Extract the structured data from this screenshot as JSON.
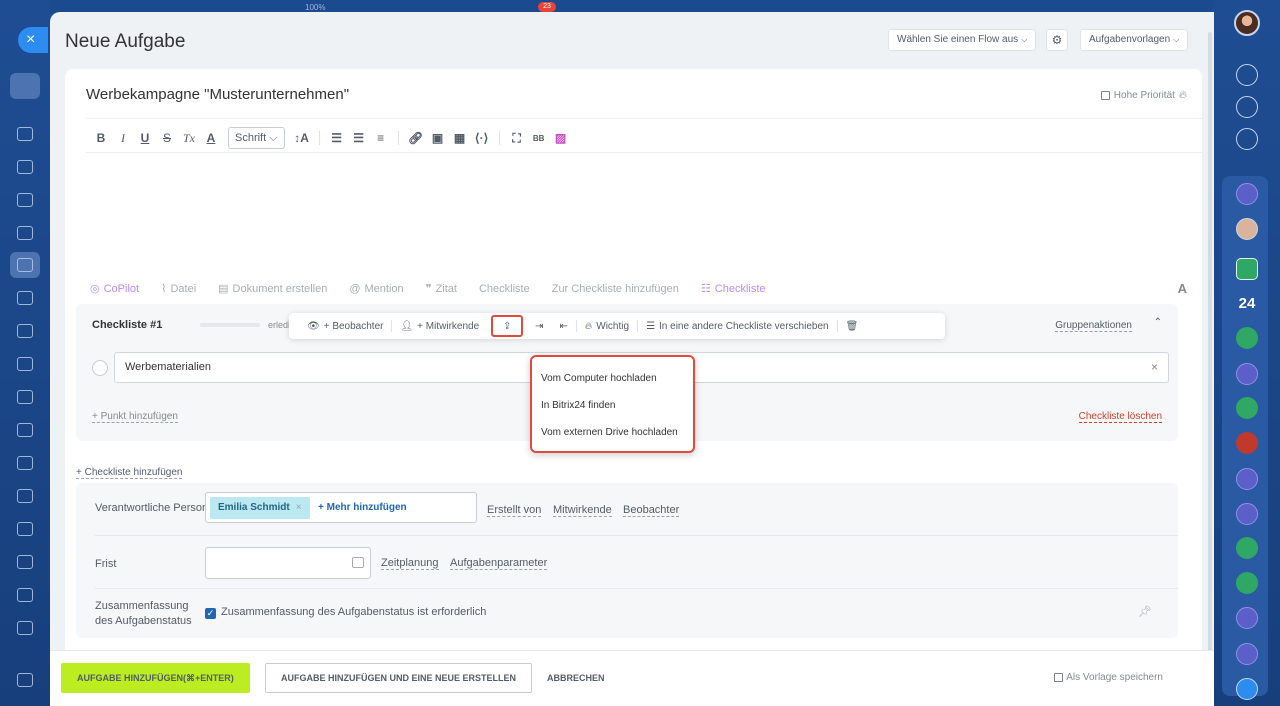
{
  "background": {
    "top_percent": "100%",
    "top_counter": "23",
    "right_rail_count": "24"
  },
  "header": {
    "title": "Neue Aufgabe",
    "flow_select": "Wählen Sie einen Flow aus",
    "templates": "Aufgabenvorlagen"
  },
  "task": {
    "title": "Werbekampagne \"Musterunternehmen\"",
    "high_priority": "Hohe Priorität"
  },
  "editor": {
    "toolbar": {
      "bold": "B",
      "italic": "I",
      "underline": "U",
      "strike": "S",
      "clear": "Tx",
      "color": "A",
      "font": "Schrift",
      "font_size": "↕A"
    },
    "actions": {
      "copilot": "CoPilot",
      "file": "Datei",
      "create_doc": "Dokument erstellen",
      "mention": "Mention",
      "quote": "Zitat",
      "checklist": "Checkliste",
      "add_to_checklist": "Zur Checkliste hinzufügen",
      "checklist_active": "Checkliste",
      "format": "A"
    }
  },
  "checklist": {
    "title": "Checkliste #1",
    "done": "erledigt: 0 von 1",
    "group_actions": "Gruppenaktionen",
    "item": "Werbematerialien",
    "add_item": "+ Punkt hinzufügen",
    "delete": "Checkliste löschen",
    "add_checklist": "+ Checkliste hinzufügen",
    "item_toolbar": {
      "observer": "+ Beobachter",
      "participant": "+ Mitwirkende",
      "important": "Wichtig",
      "move": "In eine andere Checkliste verschieben"
    },
    "upload_menu": [
      "Vom Computer hochladen",
      "In Bitrix24 finden",
      "Vom externen Drive hochladen"
    ]
  },
  "meta": {
    "responsible_label": "Verantwortliche Person",
    "responsible_chip": "Emilia Schmidt",
    "add_more": "+ Mehr hinzufügen",
    "created_by": "Erstellt von",
    "participants": "Mitwirkende",
    "observers": "Beobachter",
    "deadline_label": "Frist",
    "planning": "Zeitplanung",
    "parameters": "Aufgabenparameter",
    "summary_label": "Zusammenfassung des Aufgabenstatus",
    "summary_check": "Zusammenfassung des Aufgabenstatus ist erforderlich"
  },
  "footer": {
    "add_task": "AUFGABE HINZUFÜGEN(⌘+ENTER)",
    "add_and_new": "AUFGABE HINZUFÜGEN UND EINE NEUE ERSTELLEN",
    "cancel": "ABBRECHEN",
    "save_template": "Als Vorlage speichern"
  },
  "colors": {
    "accent_green": "#bbed21",
    "highlight_red": "#e24a3d",
    "chip_blue": "#bce8f1",
    "link_blue": "#2067b0"
  }
}
